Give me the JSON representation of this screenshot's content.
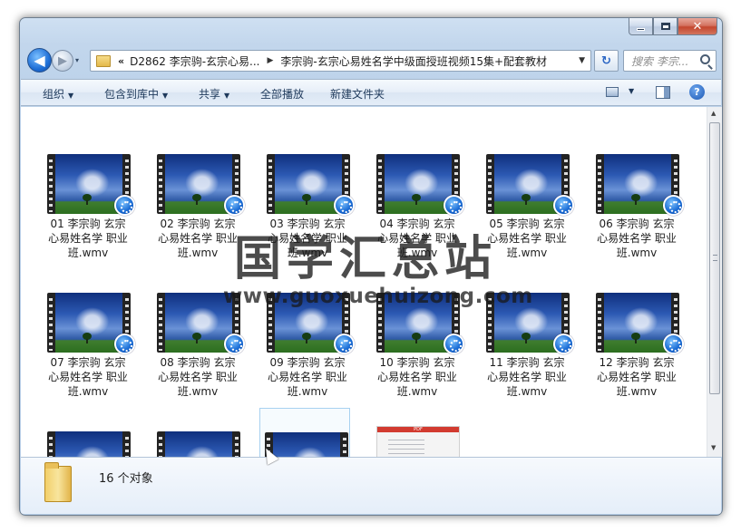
{
  "window": {
    "caption": {
      "minimize_label": "",
      "close_label": "✕"
    }
  },
  "nav": {
    "back_glyph": "◀",
    "forward_glyph": "▶",
    "history_glyph": "▾",
    "breadcrumb_chevron": "«",
    "breadcrumb": [
      "D2862 李宗驹-玄宗心易...",
      "李宗驹-玄宗心易姓名学中级面授班视频15集+配套教材"
    ],
    "separator_glyph": "▶",
    "dropdown_glyph": "▼",
    "refresh_glyph": "↻",
    "search_placeholder": "搜索 李宗..."
  },
  "toolbar": {
    "organize": "组织",
    "include_in_library": "包含到库中",
    "share": "共享",
    "play_all": "全部播放",
    "new_folder": "新建文件夹",
    "dropdown_glyph": "▼",
    "help_glyph": "?"
  },
  "files": [
    {
      "line1": "01 李宗驹 玄宗",
      "line2": "心易姓名学 职业",
      "line3": "班.wmv"
    },
    {
      "line1": "02 李宗驹 玄宗",
      "line2": "心易姓名学 职业",
      "line3": "班.wmv"
    },
    {
      "line1": "03 李宗驹 玄宗",
      "line2": "心易姓名学 职业",
      "line3": "班.wmv"
    },
    {
      "line1": "04 李宗驹 玄宗",
      "line2": "心易姓名学 职业",
      "line3": "班.wmv"
    },
    {
      "line1": "05 李宗驹 玄宗",
      "line2": "心易姓名学 职业",
      "line3": "班.wmv"
    },
    {
      "line1": "06 李宗驹 玄宗",
      "line2": "心易姓名学 职业",
      "line3": "班.wmv"
    },
    {
      "line1": "07 李宗驹 玄宗",
      "line2": "心易姓名学 职业",
      "line3": "班.wmv"
    },
    {
      "line1": "08 李宗驹 玄宗",
      "line2": "心易姓名学 职业",
      "line3": "班.wmv"
    },
    {
      "line1": "09 李宗驹 玄宗",
      "line2": "心易姓名学 职业",
      "line3": "班.wmv"
    },
    {
      "line1": "10 李宗驹 玄宗",
      "line2": "心易姓名学 职业",
      "line3": "班.wmv"
    },
    {
      "line1": "11 李宗驹 玄宗",
      "line2": "心易姓名学 职业",
      "line3": "班.wmv"
    },
    {
      "line1": "12 李宗驹 玄宗",
      "line2": "心易姓名学 职业",
      "line3": "班.wmv"
    }
  ],
  "pdf_badge": "PDF",
  "status": {
    "count": "16 个对象"
  },
  "watermark": {
    "title": "国学汇总站",
    "url": "www.guoxuehuizong.com"
  },
  "scrollbar": {
    "up_glyph": "▲",
    "down_glyph": "▼"
  }
}
